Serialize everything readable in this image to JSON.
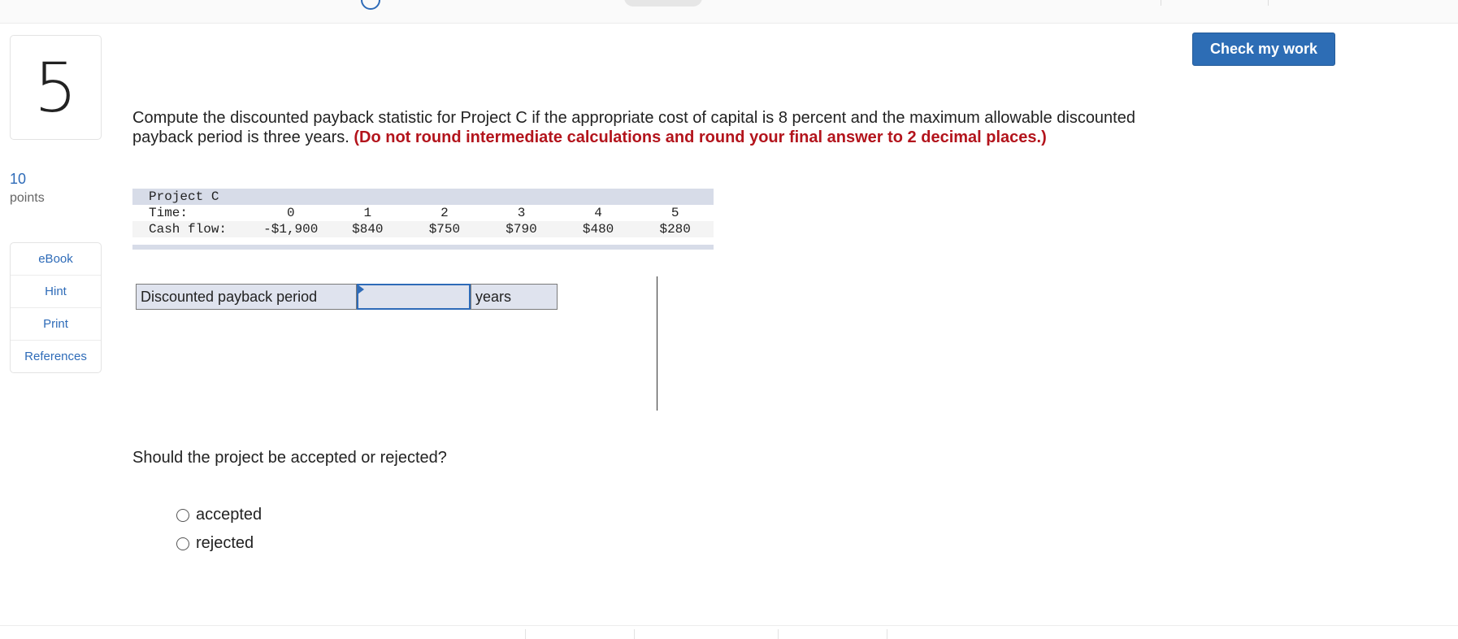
{
  "question": {
    "number": "5",
    "points_value": "10",
    "points_label": "points",
    "text": "Compute the discounted payback statistic for Project C if the appropriate cost of capital is 8 percent and the maximum allowable discounted payback period is three years.",
    "instruction": "(Do not round intermediate calculations and round your final answer to 2 decimal places.)"
  },
  "tools": [
    "eBook",
    "Hint",
    "Print",
    "References"
  ],
  "check_button_label": "Check my work",
  "project_table": {
    "title": "Project C",
    "time_label": "Time:",
    "cash_label": "Cash flow:",
    "times": [
      "0",
      "1",
      "2",
      "3",
      "4",
      "5"
    ],
    "cash_flows": [
      "-$1,900",
      "$840",
      "$750",
      "$790",
      "$480",
      "$280"
    ]
  },
  "answer_row": {
    "label": "Discounted payback period",
    "value": "",
    "unit": "years"
  },
  "decision": {
    "prompt": "Should the project be accepted or rejected?",
    "options": [
      "accepted",
      "rejected"
    ]
  },
  "colors": {
    "accent": "#2d6db5",
    "instruction_red": "#b3141c",
    "table_header_bg": "#d7dce8"
  }
}
